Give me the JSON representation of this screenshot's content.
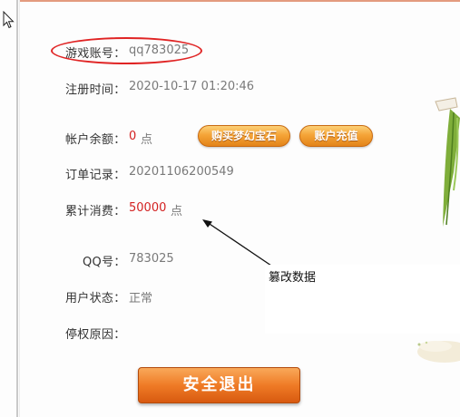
{
  "account": {
    "game_account_label": "游戏账号：",
    "game_account_value": "qq783025",
    "register_time_label": "注册时间：",
    "register_time_value": "2020-10-17 01:20:46",
    "balance_label": "帐户余额：",
    "balance_value": "0",
    "balance_unit": "点",
    "order_label": "订单记录：",
    "order_value": "20201106200549",
    "total_spend_label": "累计消费：",
    "total_spend_value": "50000",
    "total_spend_unit": "点",
    "qq_label": "QQ号：",
    "qq_value": "783025",
    "status_label": "用户状态：",
    "status_value": "正常",
    "suspend_reason_label": "停权原因："
  },
  "buttons": {
    "buy_gems": "购买梦幻宝石",
    "recharge": "账户充值",
    "logout": "安全退出"
  },
  "annotation": {
    "text": "篡改数据"
  },
  "colors": {
    "highlight_red": "#e02424",
    "value_red": "#d32222",
    "button_orange": "#f5a437",
    "logout_orange": "#ef7b26"
  }
}
